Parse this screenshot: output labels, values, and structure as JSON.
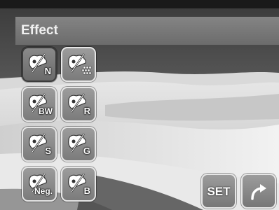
{
  "header": {
    "title": "Effect"
  },
  "effects": [
    {
      "name": "effect-normal",
      "label": "N",
      "selected": true
    },
    {
      "name": "effect-pattern",
      "label": "",
      "selected": false
    },
    {
      "name": "effect-bw",
      "label": "BW",
      "selected": false
    },
    {
      "name": "effect-red",
      "label": "R",
      "selected": false
    },
    {
      "name": "effect-sepia",
      "label": "S",
      "selected": false
    },
    {
      "name": "effect-green",
      "label": "G",
      "selected": false
    },
    {
      "name": "effect-negative",
      "label": "Neg.",
      "selected": false
    },
    {
      "name": "effect-blue",
      "label": "B",
      "selected": false
    }
  ],
  "controls": {
    "set_label": "SET",
    "back_icon": "return-arrow-icon"
  }
}
